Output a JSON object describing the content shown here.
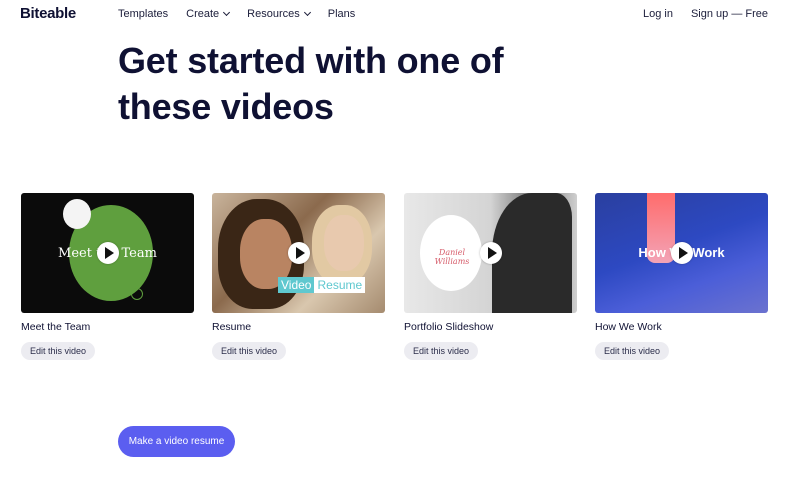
{
  "nav": {
    "logo": "Biteable",
    "links": [
      {
        "label": "Templates",
        "dropdown": false
      },
      {
        "label": "Create",
        "dropdown": true
      },
      {
        "label": "Resources",
        "dropdown": true
      },
      {
        "label": "Plans",
        "dropdown": false
      }
    ],
    "login": "Log in",
    "signup": "Sign up — Free"
  },
  "hero": {
    "title_line1": "Get started with one of",
    "title_line2": "these videos"
  },
  "cards": [
    {
      "title": "Meet the Team",
      "thumb_text": "Meet the Team",
      "edit_label": "Edit this video"
    },
    {
      "title": "Resume",
      "thumb_caption_a": "Video",
      "thumb_caption_b": "Resume",
      "edit_label": "Edit this video"
    },
    {
      "title": "Portfolio Slideshow",
      "thumb_text": "Daniel Williams",
      "edit_label": "Edit this video"
    },
    {
      "title": "How We Work",
      "thumb_text": "How We Work",
      "edit_label": "Edit this video"
    }
  ],
  "cta": {
    "label": "Make a video resume"
  },
  "colors": {
    "primary": "#5b5ef0",
    "text": "#0f1133",
    "button_bg": "#ececf1",
    "green": "#5f9f3e",
    "teal": "#5fc8cf"
  }
}
